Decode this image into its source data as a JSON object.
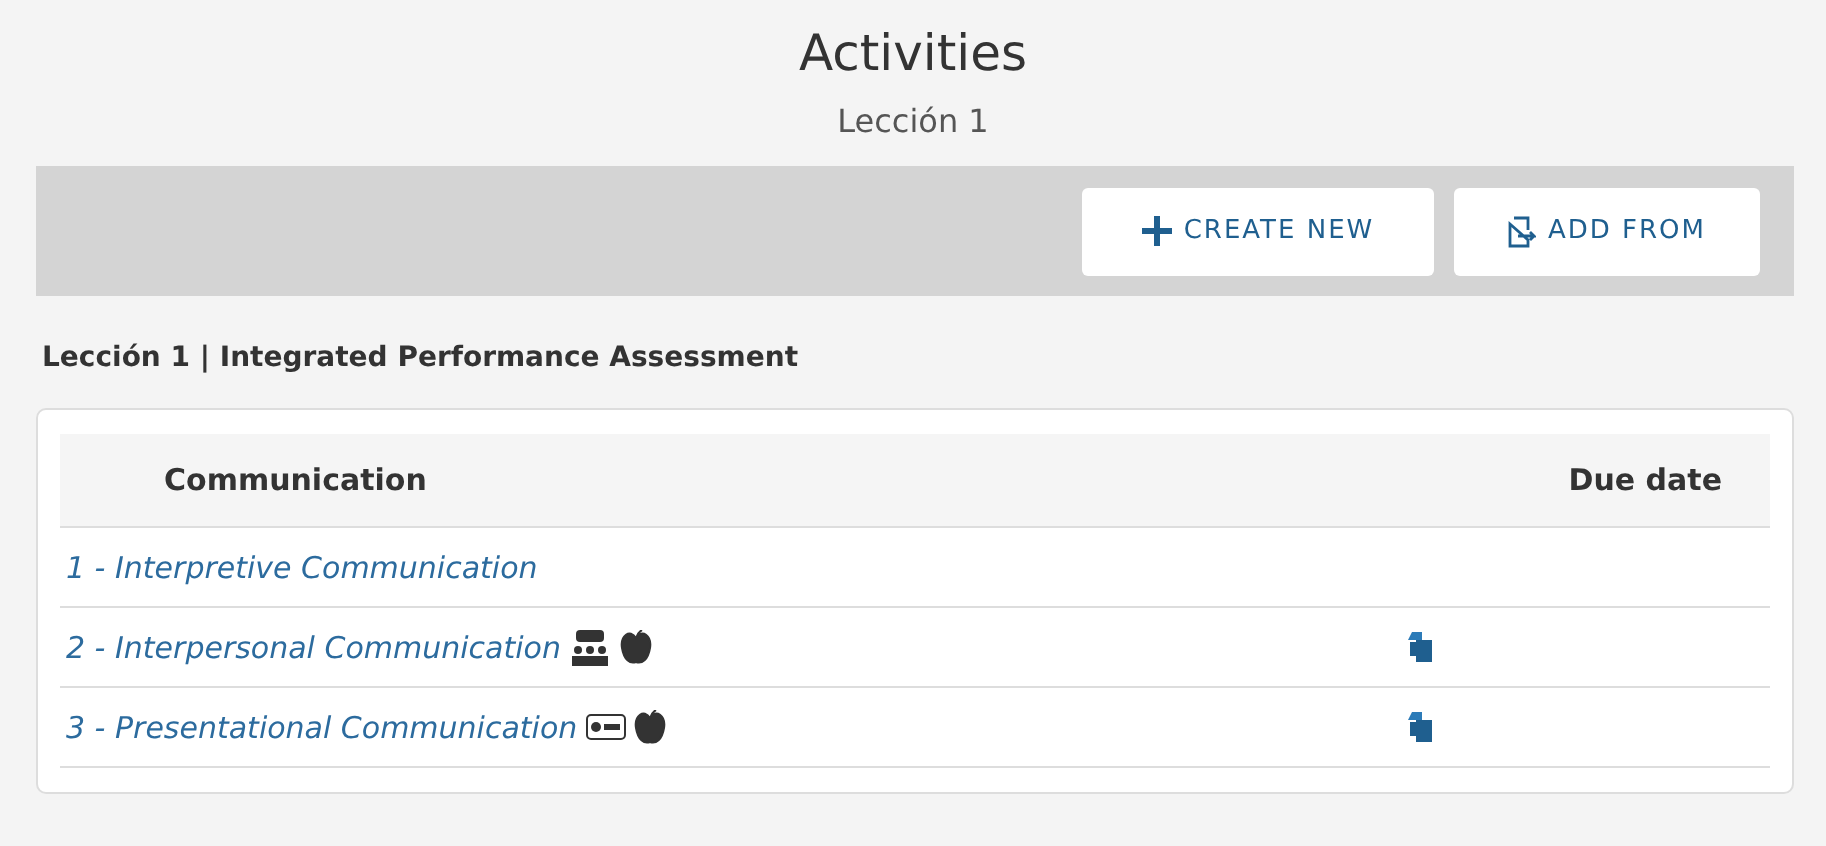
{
  "title": "Activities",
  "subtitle": "Lección 1",
  "toolbar": {
    "buttons": [
      {
        "label": "CREATE NEW",
        "kind": "create"
      },
      {
        "label": "ADD FROM",
        "kind": "add"
      }
    ]
  },
  "section_title": "Lección 1 | Integrated Performance Assessment",
  "table": {
    "columns": [
      "Communication",
      "Due date"
    ],
    "rows": [
      {
        "title": "1 - Interpretive Communication",
        "icons": [],
        "copy_icon": false
      },
      {
        "title": "2 - Interpersonal Communication",
        "icons": [
          {
            "kind": "group-chat"
          },
          {
            "kind": "apple"
          }
        ],
        "copy_icon": true
      },
      {
        "title": "3 - Presentational Communication",
        "icons": [
          {
            "kind": "recording"
          },
          {
            "kind": "apple"
          }
        ],
        "copy_icon": true
      }
    ]
  }
}
